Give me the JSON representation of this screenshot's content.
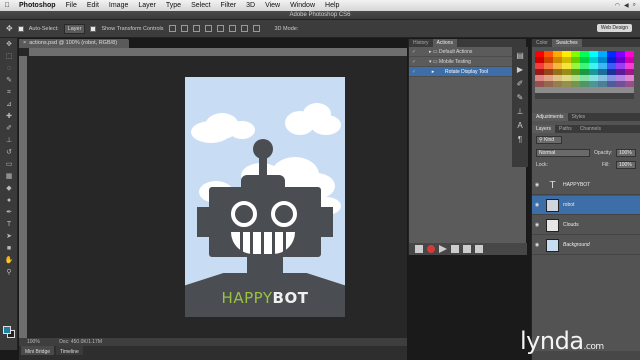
{
  "menubar": {
    "app": "Photoshop",
    "items": [
      "File",
      "Edit",
      "Image",
      "Layer",
      "Type",
      "Select",
      "Filter",
      "3D",
      "View",
      "Window",
      "Help"
    ]
  },
  "title": "Adobe Photoshop CS6",
  "options": {
    "auto_select_label": "Auto-Select:",
    "auto_select_value": "Layer",
    "transform_label": "Show Transform Controls",
    "mode_3d": "3D Mode:",
    "workspace": "Web Design"
  },
  "document": {
    "tab_label": "actions.psd @ 100% (robot, RGB/8)",
    "zoom": "100%",
    "doc_size": "Doc: 450.0K/1.17M",
    "bottom_tabs": [
      "Mini Bridge",
      "Timeline"
    ],
    "brand_happy": "HAPPY",
    "brand_bot": "BOT"
  },
  "actions_panel": {
    "tabs": [
      "History",
      "Actions"
    ],
    "rows": [
      "Default Actions",
      "Mobile Testing",
      "Rotate Display Tool"
    ]
  },
  "color_panel": {
    "tabs": [
      "Color",
      "Swatches"
    ]
  },
  "adjust_panel": {
    "tabs": [
      "Adjustments",
      "Styles"
    ]
  },
  "layers_panel": {
    "tabs": [
      "Layers",
      "Paths",
      "Channels"
    ],
    "kind": "Kind",
    "blend": "Normal",
    "opacity_label": "Opacity:",
    "opacity": "100%",
    "lock_label": "Lock:",
    "fill_label": "Fill:",
    "fill": "100%",
    "layers": [
      "HAPPYBOT",
      "robot",
      "Clouds",
      "Background"
    ]
  },
  "watermark": {
    "brand": "lynda",
    "tld": "com"
  },
  "colors": {
    "accent": "#3d6ea8",
    "brand_green": "#9cc23d",
    "robot": "#4a4d52",
    "sky": "#c8dcf4"
  }
}
